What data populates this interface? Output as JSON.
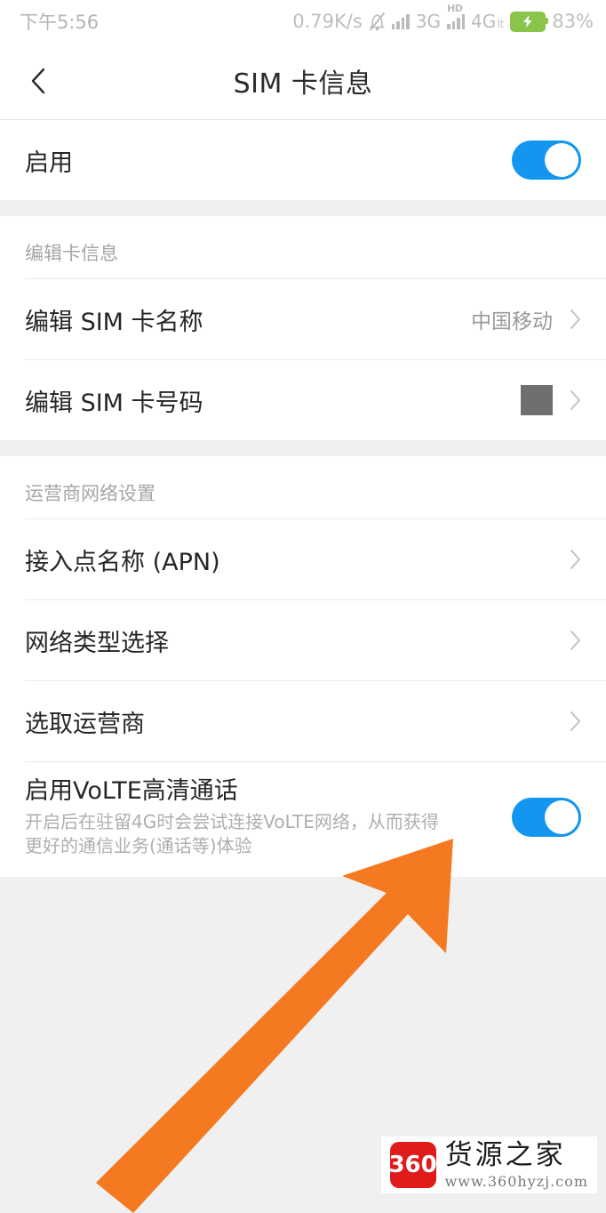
{
  "statusbar": {
    "time": "下午5:56",
    "netspeed": "0.79K/s",
    "mute_icon": "bell-off-icon",
    "signal1_icon": "signal-bars-icon",
    "net1_label": "3G",
    "hd_label": "HD",
    "signal2_icon": "signal-bars-icon",
    "net2_label": "4G",
    "net2_sub": "lt",
    "battery_icon": "battery-charging-icon",
    "battery_percent": "83%"
  },
  "appbar": {
    "back_icon": "chevron-left-icon",
    "title": "SIM 卡信息"
  },
  "enable_row": {
    "label": "启用",
    "toggle_state": "on"
  },
  "section_card": {
    "label": "编辑卡信息",
    "rows": [
      {
        "label": "编辑 SIM 卡名称",
        "value": "中国移动",
        "value_type": "text",
        "chevron": "chevron-right-icon"
      },
      {
        "label": "编辑 SIM 卡号码",
        "value": "",
        "value_type": "redacted",
        "chevron": "chevron-right-icon"
      }
    ]
  },
  "section_operator": {
    "label": "运营商网络设置",
    "rows": [
      {
        "label": "接入点名称 (APN)",
        "chevron": "chevron-right-icon"
      },
      {
        "label": "网络类型选择",
        "chevron": "chevron-right-icon"
      },
      {
        "label": "选取运营商",
        "chevron": "chevron-right-icon"
      }
    ],
    "volte": {
      "title": "启用VoLTE高清通话",
      "description": "开启后在驻留4G时会尝试连接VoLTE网络，从而获得更好的通信业务(通话等)体验",
      "toggle_state": "on"
    }
  },
  "annotation": {
    "arrow_icon": "arrow-up-right-icon",
    "arrow_color": "#F47920"
  },
  "watermark": {
    "badge": "360",
    "name": "货源之家",
    "url": "www.360hyzj.com",
    "badge_color": "#E01B1B"
  },
  "colors": {
    "accent": "#1296F0",
    "background": "#F0F0F0",
    "card": "#FFFFFF",
    "battery": "#8AC44A"
  }
}
